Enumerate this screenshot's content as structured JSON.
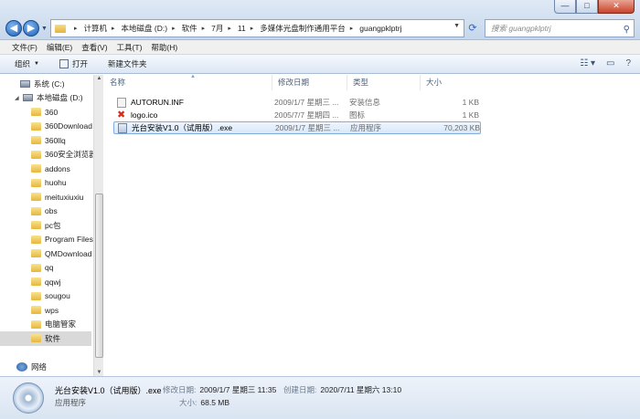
{
  "window": {
    "min_label": "—",
    "max_label": "□",
    "close_label": "✕"
  },
  "address": {
    "crumbs": [
      "计算机",
      "本地磁盘 (D:)",
      "软件",
      "7月",
      "11",
      "多媒体光盘制作通用平台",
      "guangpklptrj"
    ]
  },
  "search": {
    "placeholder": "搜索 guangpklptrj"
  },
  "menu": [
    "文件(F)",
    "编辑(E)",
    "查看(V)",
    "工具(T)",
    "帮助(H)"
  ],
  "toolbar": {
    "organize": "组织",
    "open": "打开",
    "new_folder": "新建文件夹"
  },
  "nav": {
    "system_drive": "系统 (C:)",
    "local_drive": "本地磁盘 (D:)",
    "folders": [
      "360",
      "360Download",
      "360llq",
      "360安全浏览器",
      "addons",
      "huohu",
      "meituxiuxiu",
      "obs",
      "pc包",
      "Program Files",
      "QMDownload",
      "qq",
      "qqwj",
      "sougou",
      "wps",
      "电脑管家",
      "软件"
    ],
    "network": "网络"
  },
  "columns": {
    "name": "名称",
    "date": "修改日期",
    "type": "类型",
    "size": "大小"
  },
  "files": [
    {
      "name": "AUTORUN.INF",
      "date": "2009/1/7 星期三 ...",
      "type": "安装信息",
      "size": "1 KB",
      "icon": "inf-file-icon"
    },
    {
      "name": "logo.ico",
      "date": "2005/7/7 星期四 ...",
      "type": "图标",
      "size": "1 KB",
      "icon": "ico-file-icon"
    },
    {
      "name": "光台安装V1.0（试用版）.exe",
      "date": "2009/1/7 星期三 ...",
      "type": "应用程序",
      "size": "70,203 KB",
      "icon": "exe-file-icon"
    }
  ],
  "details": {
    "name": "光台安装V1.0（试用版）.exe",
    "type": "应用程序",
    "modified_label": "修改日期:",
    "modified_value": "2009/1/7 星期三 11:35",
    "created_label": "创建日期:",
    "created_value": "2020/7/11 星期六 13:10",
    "size_label": "大小:",
    "size_value": "68.5 MB"
  }
}
